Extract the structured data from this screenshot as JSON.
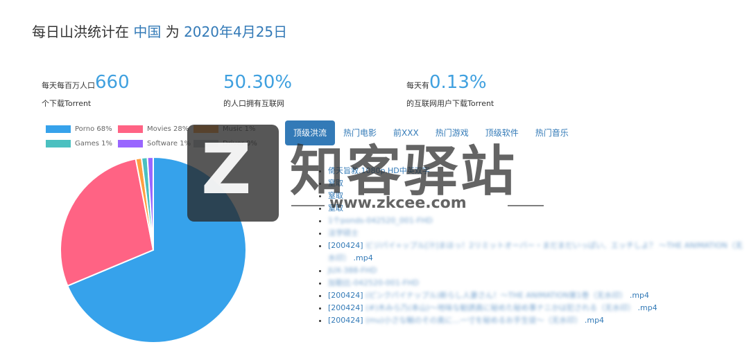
{
  "header": {
    "title_prefix": "每日山洪统计在",
    "country": "中国",
    "connector": "为",
    "date": "2020年4月25日"
  },
  "stats": [
    {
      "pre": "每天每百万人口",
      "value": "660",
      "sub": "个下载Torrent"
    },
    {
      "pre": "",
      "value": "50.30%",
      "sub": "的人口拥有互联网"
    },
    {
      "pre": "每天有",
      "value": "0.13%",
      "sub": "的互联网用户下载Torrent"
    }
  ],
  "chart_data": {
    "type": "pie",
    "categories": [
      "Porno",
      "Movies",
      "Music",
      "Games",
      "Software",
      "Driver"
    ],
    "values": [
      68,
      28,
      1,
      1,
      1,
      0
    ],
    "legend_labels": [
      "Porno 68%",
      "Movies 28%",
      "Music 1%",
      "Games 1%",
      "Software 1%",
      "Driver 0%"
    ],
    "colors": [
      "#36a2eb",
      "#ff6384",
      "#ff9f40",
      "#4bc0c0",
      "#9966ff",
      "#c9cbcf"
    ],
    "legend_position": "top"
  },
  "tabs": [
    {
      "label": "顶级洪流",
      "active": true
    },
    {
      "label": "热门电影",
      "active": false
    },
    {
      "label": "前XXX",
      "active": false
    },
    {
      "label": "热门游戏",
      "active": false
    },
    {
      "label": "顶级软件",
      "active": false
    },
    {
      "label": "热门音乐",
      "active": false
    }
  ],
  "list": [
    {
      "prefix": "",
      "text": "倚天旨救.1080p.HD中英双字",
      "suffix": ""
    },
    {
      "prefix": "",
      "text": "窒取",
      "suffix": ""
    },
    {
      "prefix": "",
      "text": "窒取",
      "suffix": ""
    },
    {
      "prefix": "",
      "text": "窒取",
      "suffix": ""
    },
    {
      "prefix": "",
      "text": "1个ponds-042520_001-FHD",
      "suffix": ""
    },
    {
      "prefix": "",
      "text": "法学硕士",
      "suffix": ""
    },
    {
      "prefix": "[200424]",
      "text": "ビジパイ+ップル[汁]まほっ！2リミットオーバー・まだまだいっぱい、エッチしよ？ ～THE ANIMATION（无水印）",
      "suffix": ".mp4"
    },
    {
      "prefix": "",
      "text": "JUX-388-FHD",
      "suffix": ""
    },
    {
      "prefix": "",
      "text": "加勒比-042520-001-FHD",
      "suffix": ""
    },
    {
      "prefix": "[200424]",
      "text": "(ピンクパイナップル)新らし人妻さん！～THE ANIMATION第1巻（无水印）",
      "suffix": ".mp4"
    },
    {
      "prefix": "[200424]",
      "text": "(#)木みら乃(本山)～地味な勧誘員に秘めた秘め事ナニかは犯される（无水印）",
      "suffix": ".mp4"
    },
    {
      "prefix": "[200424]",
      "text": "(mu)小さな輸のその奥に…一寸を秘めるお手生徒～（无水印）",
      "suffix": ".mp4"
    }
  ],
  "watermark": {
    "logo_letter": "Z",
    "brand": "知客驿站",
    "url": "www.zkcee.com"
  }
}
